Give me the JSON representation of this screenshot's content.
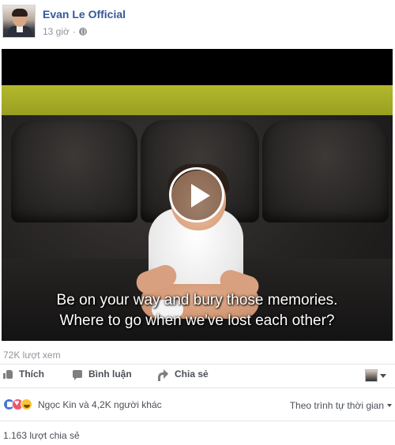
{
  "post": {
    "author": "Evan Le Official",
    "time": "13 giờ",
    "separator": "·",
    "privacy_icon": "globe-icon"
  },
  "video": {
    "subtitle_line_1": "Be on your way and bury those memories.",
    "subtitle_line_2": "Where to go when we've lost each other?",
    "play_icon": "play-icon"
  },
  "stats": {
    "views": "72K lượt xem",
    "shares": "1.163 lượt chia sẻ"
  },
  "actions": {
    "like": "Thích",
    "comment": "Bình luận",
    "share": "Chia sẻ"
  },
  "reactions": {
    "icons": [
      "like",
      "love",
      "haha"
    ],
    "summary": "Ngọc Kin và 4,2K người khác",
    "sort_label": "Theo trình tự thời gian"
  },
  "colors": {
    "link_blue": "#365899",
    "meta_gray": "#90949c",
    "text_dark": "#4b4f56",
    "like_blue": "#4a78d0",
    "love_red": "#f25268",
    "haha_yellow": "#f7c534"
  }
}
